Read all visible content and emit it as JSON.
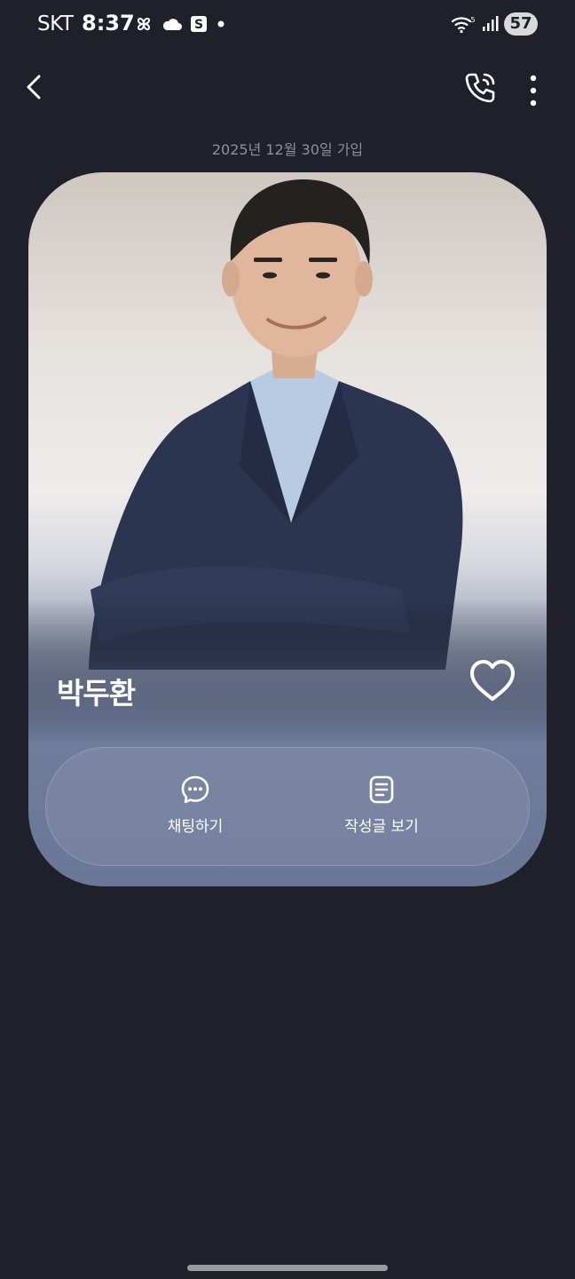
{
  "status_bar": {
    "carrier": "SKT",
    "time": "8:37",
    "battery": "57",
    "icons": [
      "pinwheel-icon",
      "cloud-icon",
      "s-app-icon",
      "dot-icon",
      "wifi-icon",
      "signal-icon"
    ]
  },
  "app_bar": {
    "back_icon": "chevron-left-icon",
    "call_icon": "phone-call-icon",
    "more_icon": "more-vert-icon"
  },
  "join_date": "2025년 12월 30일 가입",
  "profile": {
    "name": "박두환",
    "favorite_icon": "heart-outline-icon"
  },
  "actions": {
    "chat_label": "채팅하기",
    "posts_label": "작성글 보기"
  },
  "colors": {
    "background": "#1f2029",
    "card_bottom": "#6a7797",
    "muted_text": "#8e909a"
  }
}
